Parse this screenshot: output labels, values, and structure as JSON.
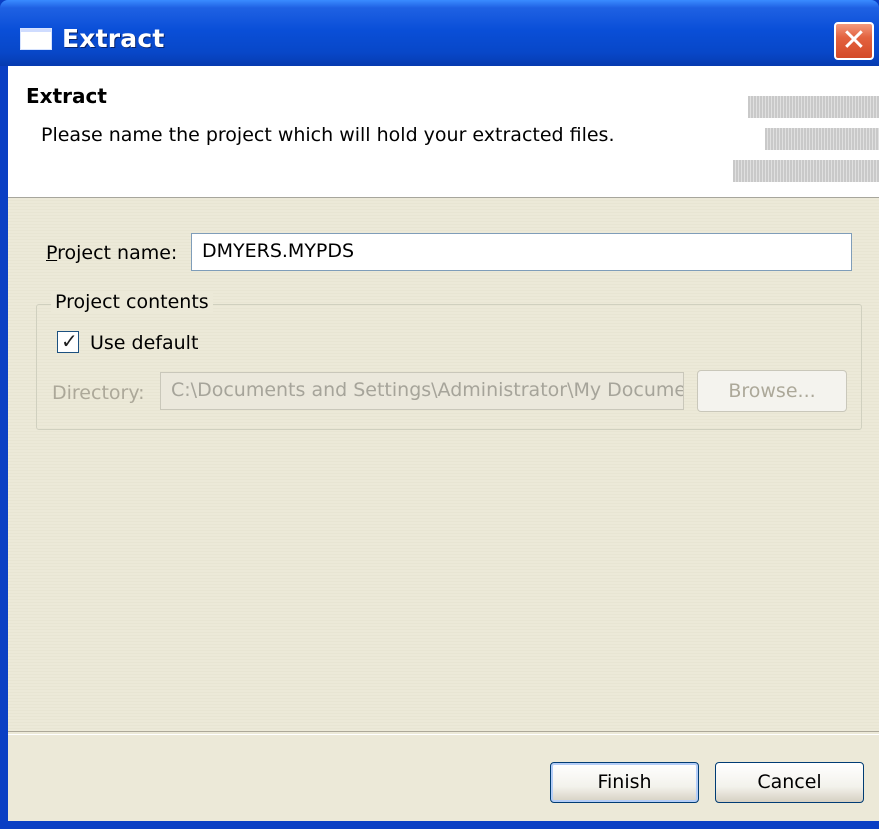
{
  "window": {
    "title": "Extract"
  },
  "header": {
    "title": "Extract",
    "message": "Please name the project which will hold your extracted files."
  },
  "form": {
    "project_name_label": "Project name:",
    "project_name_value": "DMYERS.MYPDS",
    "group_label": "Project contents",
    "use_default_label": "Use default",
    "use_default_checked": true,
    "directory_label": "Directory:",
    "directory_value": "C:\\Documents and Settings\\Administrator\\My Documents",
    "browse_label": "Browse..."
  },
  "buttons": {
    "finish_label": "Finish",
    "cancel_label": "Cancel"
  },
  "colors": {
    "titlebar": "#0a4fd8",
    "close_button": "#d44a27",
    "dialog_background": "#ece9d8"
  }
}
